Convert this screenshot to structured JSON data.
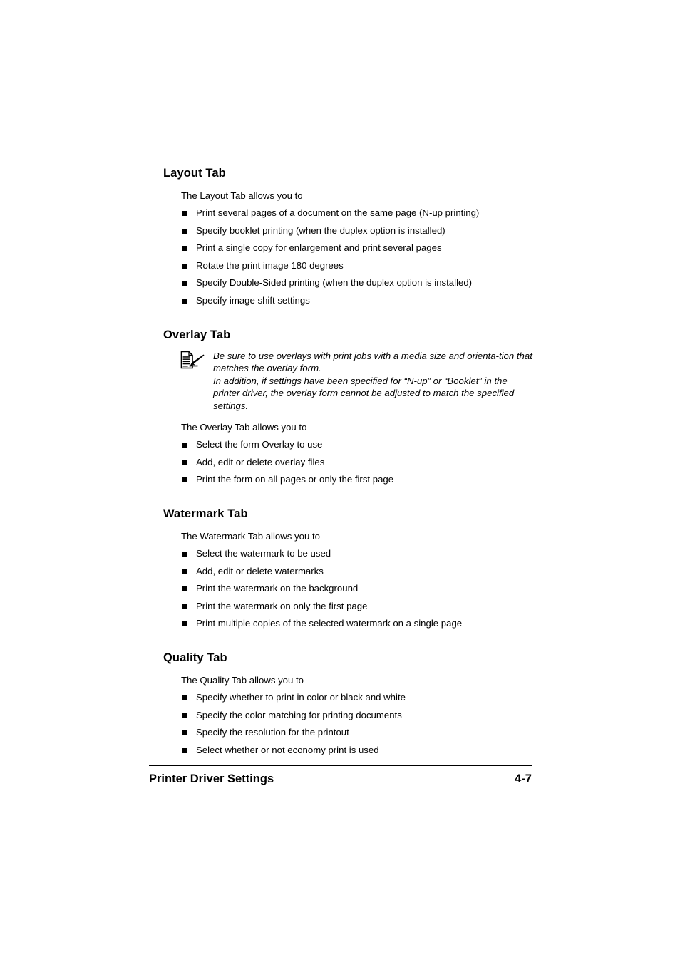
{
  "document": {
    "background_color": "#ffffff",
    "text_color": "#000000"
  },
  "sections": [
    {
      "heading": "Layout Tab",
      "intro": "The Layout Tab allows you to",
      "bullets": [
        "Print several pages of a document on the same page (N-up printing)",
        "Specify booklet printing (when the duplex option is installed)",
        "Print a single copy for enlargement and print several pages",
        "Rotate the print image 180 degrees",
        "Specify Double-Sided printing (when the duplex option is installed)",
        "Specify image shift settings"
      ]
    },
    {
      "heading": "Overlay Tab",
      "note": {
        "icon": "note-document-pen-icon",
        "paragraphs": [
          "Be sure to use overlays with print jobs with a media size and orienta-tion that matches the overlay form.",
          "In addition, if settings have been specified for “N-up” or “Booklet” in the printer driver, the overlay form cannot be adjusted to match the specified settings."
        ]
      },
      "intro": "The Overlay Tab allows you to",
      "bullets": [
        "Select the form Overlay to use",
        "Add, edit or delete overlay files",
        "Print the form on all pages or only the first page"
      ]
    },
    {
      "heading": "Watermark Tab",
      "intro": "The Watermark Tab allows you to",
      "bullets": [
        "Select the watermark to be used",
        "Add, edit or delete watermarks",
        "Print the watermark on the background",
        "Print the watermark on only the first page",
        "Print multiple copies of the selected watermark on a single page"
      ]
    },
    {
      "heading": "Quality Tab",
      "intro": "The Quality Tab allows you to",
      "bullets": [
        "Specify whether to print in color or black and white",
        "Specify the color matching for printing documents",
        "Specify the resolution for the printout",
        "Select whether or not economy print is used"
      ]
    }
  ],
  "footer": {
    "title": "Printer Driver Settings",
    "page_number": "4-7"
  }
}
